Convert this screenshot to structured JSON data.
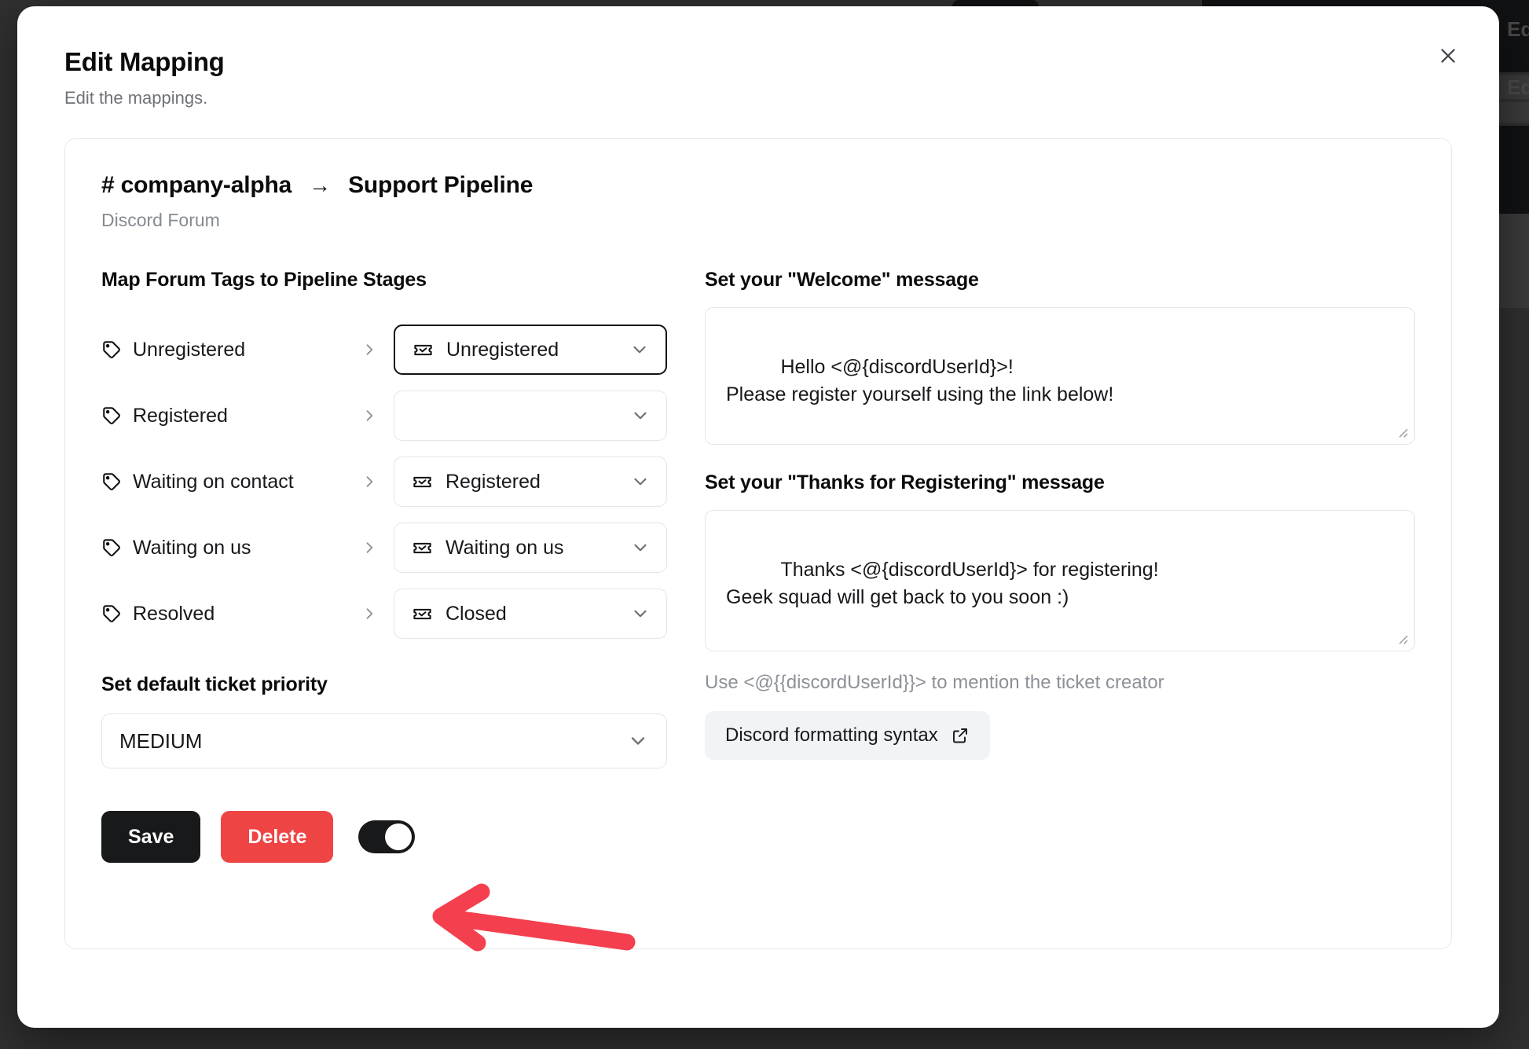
{
  "background": {
    "hidden_label_1": "Ed",
    "hidden_label_2": "Ed"
  },
  "modal": {
    "title": "Edit Mapping",
    "subtitle": "Edit the mappings.",
    "close_label": "×"
  },
  "card": {
    "breadcrumb": {
      "channel": "# company-alpha",
      "arrow": "→",
      "pipeline": "Support Pipeline"
    },
    "source_label": "Discord Forum"
  },
  "mapping": {
    "heading": "Map Forum Tags to Pipeline Stages",
    "rows": [
      {
        "tag": "Unregistered",
        "stage": "Unregistered",
        "focused": true,
        "empty": false
      },
      {
        "tag": "Registered",
        "stage": "",
        "focused": false,
        "empty": true
      },
      {
        "tag": "Waiting on contact",
        "stage": "Registered",
        "focused": false,
        "empty": false
      },
      {
        "tag": "Waiting on us",
        "stage": "Waiting on us",
        "focused": false,
        "empty": false
      },
      {
        "tag": "Resolved",
        "stage": "Closed",
        "focused": false,
        "empty": false
      }
    ]
  },
  "priority": {
    "heading": "Set default ticket priority",
    "value": "MEDIUM"
  },
  "actions": {
    "save_label": "Save",
    "delete_label": "Delete",
    "toggle_state": "on"
  },
  "welcome": {
    "label": "Set your \"Welcome\" message",
    "value": "Hello <@{discordUserId}>!\nPlease register yourself using the link below!"
  },
  "thanks": {
    "label": "Set your \"Thanks for Registering\" message",
    "value": "Thanks <@{discordUserId}> for registering!\nGeek squad will get back to you soon :)"
  },
  "helper": {
    "hint": "Use <@{{discordUserId}}> to mention the ticket creator",
    "link_label": "Discord formatting syntax"
  },
  "colors": {
    "accent_delete": "#ef4444",
    "save_bg": "#18191b",
    "annotation_arrow": "#f43f4e",
    "page_backdrop": "#303030"
  }
}
